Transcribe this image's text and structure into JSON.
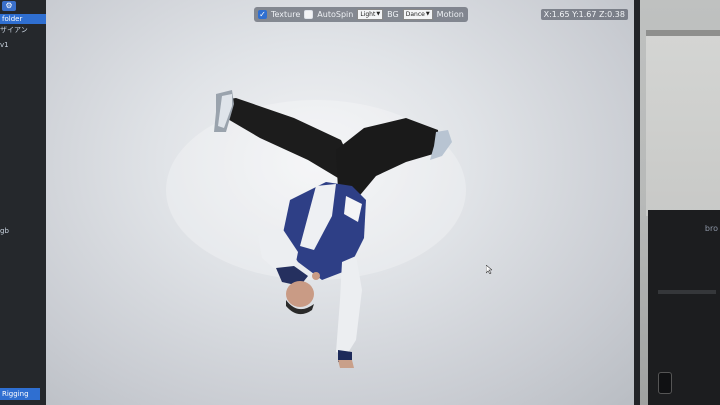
{
  "sidebar": {
    "items": [
      {
        "label": "folder",
        "selected": true
      },
      {
        "label": "ザイアン",
        "selected": false
      },
      {
        "label": "v1",
        "selected": false
      },
      {
        "label": "gb",
        "selected": false
      }
    ],
    "bottom_button": "Rigging",
    "collapse_glyph": "⋮"
  },
  "toolbar": {
    "texture_label": "Texture",
    "texture_checked": true,
    "autospin_label": "AutoSpin",
    "autospin_checked": false,
    "light_value": "Light",
    "bg_label": "BG",
    "bg_value": "Dance",
    "motion_label": "Motion"
  },
  "coords": "X:1.65 Y:1.67 Z:0.38",
  "printer_brand": "bro",
  "colors": {
    "accent": "#2f6fd1",
    "jacket_blue": "#2e3f86",
    "pants": "#1a1a1a"
  }
}
